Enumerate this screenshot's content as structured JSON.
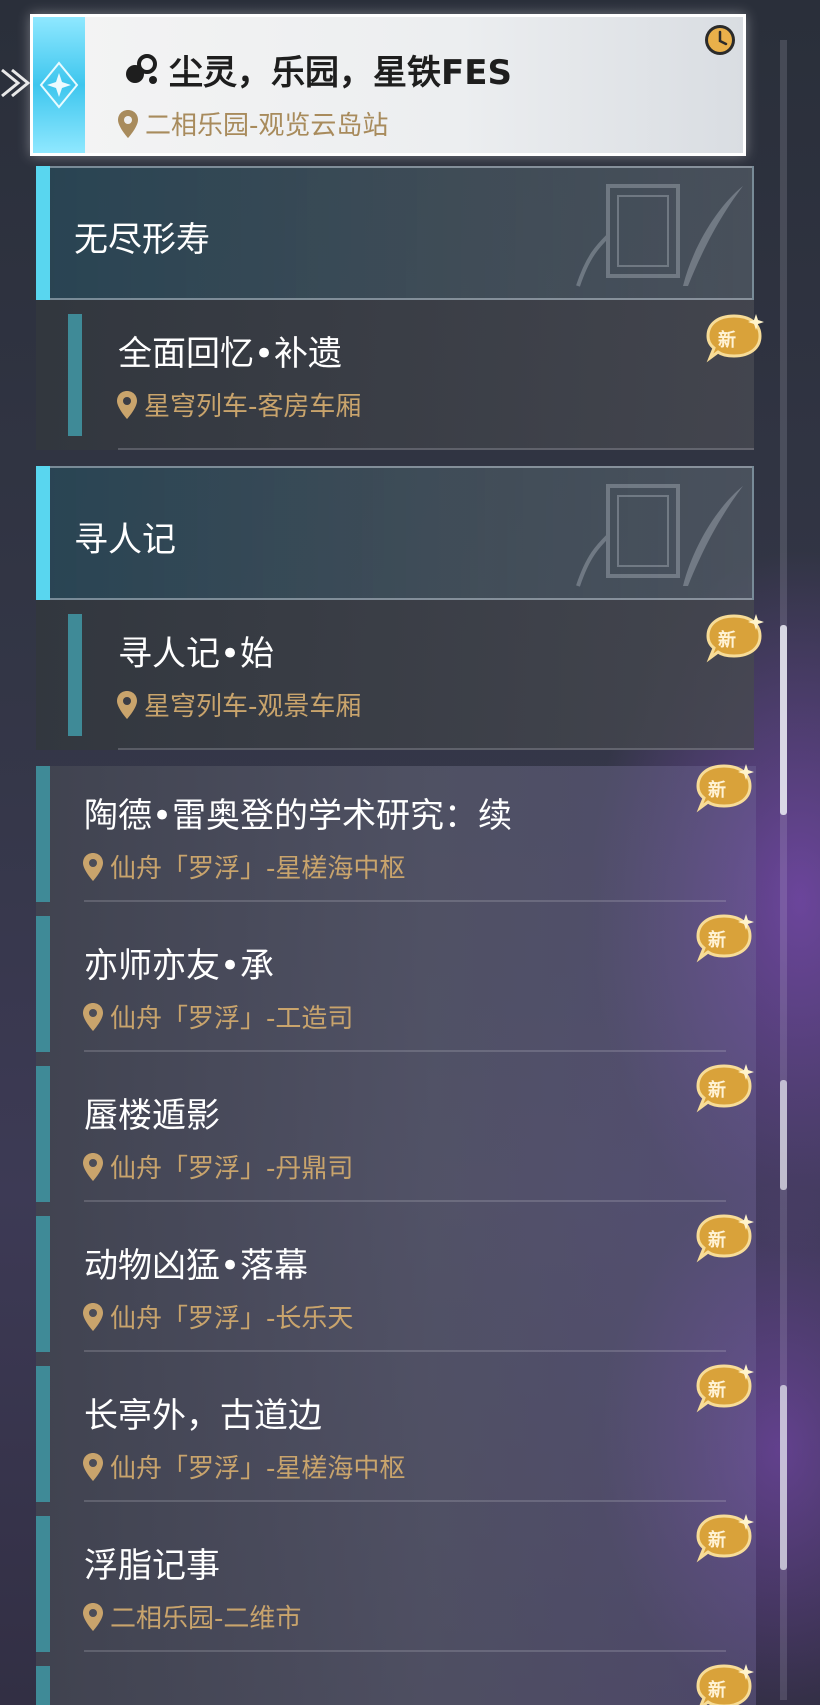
{
  "pinned": {
    "title": "尘灵，乐园，星铁FES",
    "location": "二相乐园-观览云岛站"
  },
  "groups": [
    {
      "label": "无尽形寿",
      "items": [
        {
          "title": "全面回忆•补遗",
          "location": "星穹列车-客房车厢",
          "badge": "新"
        }
      ]
    },
    {
      "label": "寻人记",
      "items": [
        {
          "title": "寻人记•始",
          "location": "星穹列车-观景车厢",
          "badge": "新"
        }
      ]
    }
  ],
  "items": [
    {
      "title": "陶德•雷奥登的学术研究：续",
      "location": "仙舟「罗浮」-星槎海中枢",
      "badge": "新"
    },
    {
      "title": "亦师亦友•承",
      "location": "仙舟「罗浮」-工造司",
      "badge": "新"
    },
    {
      "title": "蜃楼遁影",
      "location": "仙舟「罗浮」-丹鼎司",
      "badge": "新"
    },
    {
      "title": "动物凶猛•落幕",
      "location": "仙舟「罗浮」-长乐天",
      "badge": "新"
    },
    {
      "title": "长亭外，古道边",
      "location": "仙舟「罗浮」-星槎海中枢",
      "badge": "新"
    },
    {
      "title": "浮脂记事",
      "location": "二相乐园-二维市",
      "badge": "新"
    }
  ],
  "trailing_badge": "新",
  "colors": {
    "accent_cyan": "#59d6ef",
    "accent_teal": "#3f8a97",
    "location_gold": "#c9a46c",
    "badge_gold": "#d9a23a"
  }
}
